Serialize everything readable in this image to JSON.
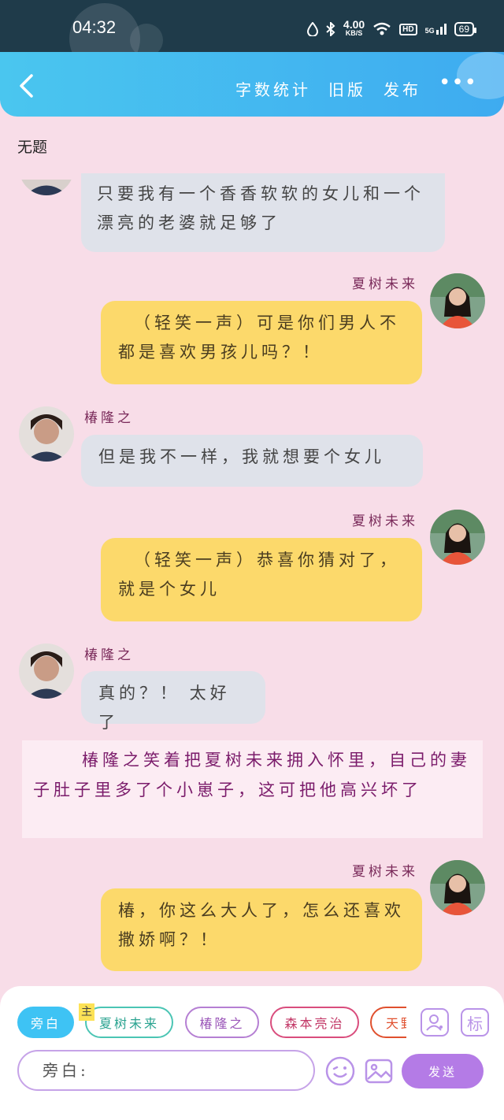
{
  "status_bar": {
    "time": "04:32",
    "net_speed": "4.00",
    "net_unit": "KB/S",
    "hd": "HD",
    "signal": "5G",
    "battery": "69"
  },
  "header": {
    "menu": [
      "字数统计",
      "旧版",
      "发布"
    ],
    "more": "•••"
  },
  "doc_title": "无题",
  "messages": [
    {
      "text": "只要我有一个香香软软的女儿和一个漂亮的老婆就足够了"
    },
    {
      "name": "夏树未来",
      "text": "（轻笑一声）可是你们男人不都是喜欢男孩儿吗？！"
    },
    {
      "name": "椿隆之",
      "text": "但是我不一样，我就想要个女儿"
    },
    {
      "name": "夏树未来",
      "text": "（轻笑一声）恭喜你猜对了，就是个女儿"
    },
    {
      "name": "椿隆之",
      "text": "真的？！ 太好了"
    },
    {
      "name": "夏树未来",
      "text": "椿，你这么大人了，怎么还喜欢撒娇啊？！"
    }
  ],
  "narration": "椿隆之笑着把夏树未来拥入怀里，自己的妻子肚子里多了个小崽子，这可把他高兴坏了",
  "bottom": {
    "roles": [
      "旁白",
      "夏树未来",
      "椿隆之",
      "森本亮治",
      "天野"
    ],
    "main_tag": "主",
    "tag_icon_label": "标",
    "input_placeholder": "旁白:",
    "send_label": "发送"
  },
  "colors": {
    "background": "#f8dde8",
    "header": "#3eabf0",
    "yellow_bubble": "#fcd96b",
    "gray_bubble": "#dfe2ea",
    "accent": "#b47be6"
  }
}
